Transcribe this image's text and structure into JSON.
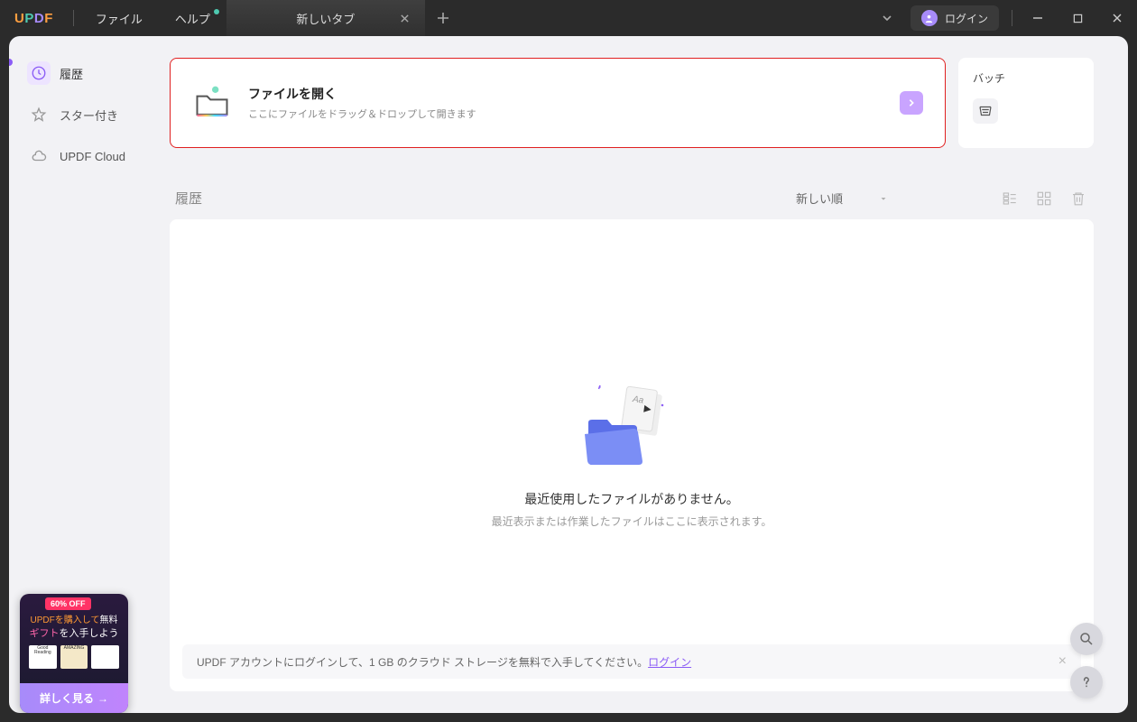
{
  "titlebar": {
    "logo": "UPDF",
    "menu": {
      "file": "ファイル",
      "help": "ヘルプ"
    },
    "tab": {
      "title": "新しいタブ"
    },
    "login": "ログイン"
  },
  "sidebar": {
    "items": [
      {
        "label": "履歴",
        "key": "history"
      },
      {
        "label": "スター付き",
        "key": "starred"
      },
      {
        "label": "UPDF Cloud",
        "key": "cloud"
      }
    ]
  },
  "main": {
    "open_file": {
      "title": "ファイルを開く",
      "subtitle": "ここにファイルをドラッグ＆ドロップして開きます"
    },
    "batch": {
      "title": "バッチ"
    },
    "history": {
      "title": "履歴",
      "sort_label": "新しい順",
      "empty_title": "最近使用したファイルがありません。",
      "empty_subtitle": "最近表示または作業したファイルはここに表示されます。"
    },
    "login_banner": {
      "text": "UPDF アカウントにログインして、1 GB のクラウド ストレージを無料で入手してください。",
      "link": "ログイン"
    }
  },
  "promo": {
    "badge": "60% OFF",
    "line1_a": "UPDFを購入して",
    "line1_b": "無料",
    "line2_a": "ギフト",
    "line2_b": "を入手しよう",
    "cta": "詳しく見る"
  }
}
